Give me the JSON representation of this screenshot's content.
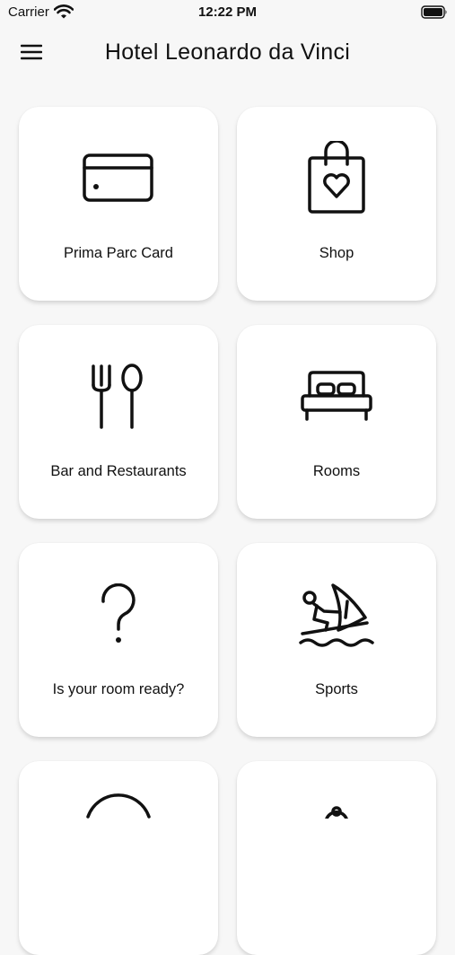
{
  "status_bar": {
    "carrier": "Carrier",
    "time": "12:22 PM"
  },
  "header": {
    "title": "Hotel Leonardo da Vinci",
    "menu_icon": "hamburger-menu-icon"
  },
  "tiles": [
    {
      "label": "Prima Parc Card",
      "icon": "credit-card-icon"
    },
    {
      "label": "Shop",
      "icon": "shopping-bag-heart-icon"
    },
    {
      "label": "Bar and Restaurants",
      "icon": "fork-spoon-icon"
    },
    {
      "label": "Rooms",
      "icon": "bed-icon"
    },
    {
      "label": "Is your room ready?",
      "icon": "question-mark-icon"
    },
    {
      "label": "Sports",
      "icon": "windsurfing-icon"
    },
    {
      "label": "",
      "icon": "circle-icon"
    },
    {
      "label": "",
      "icon": "location-pin-icon"
    }
  ]
}
